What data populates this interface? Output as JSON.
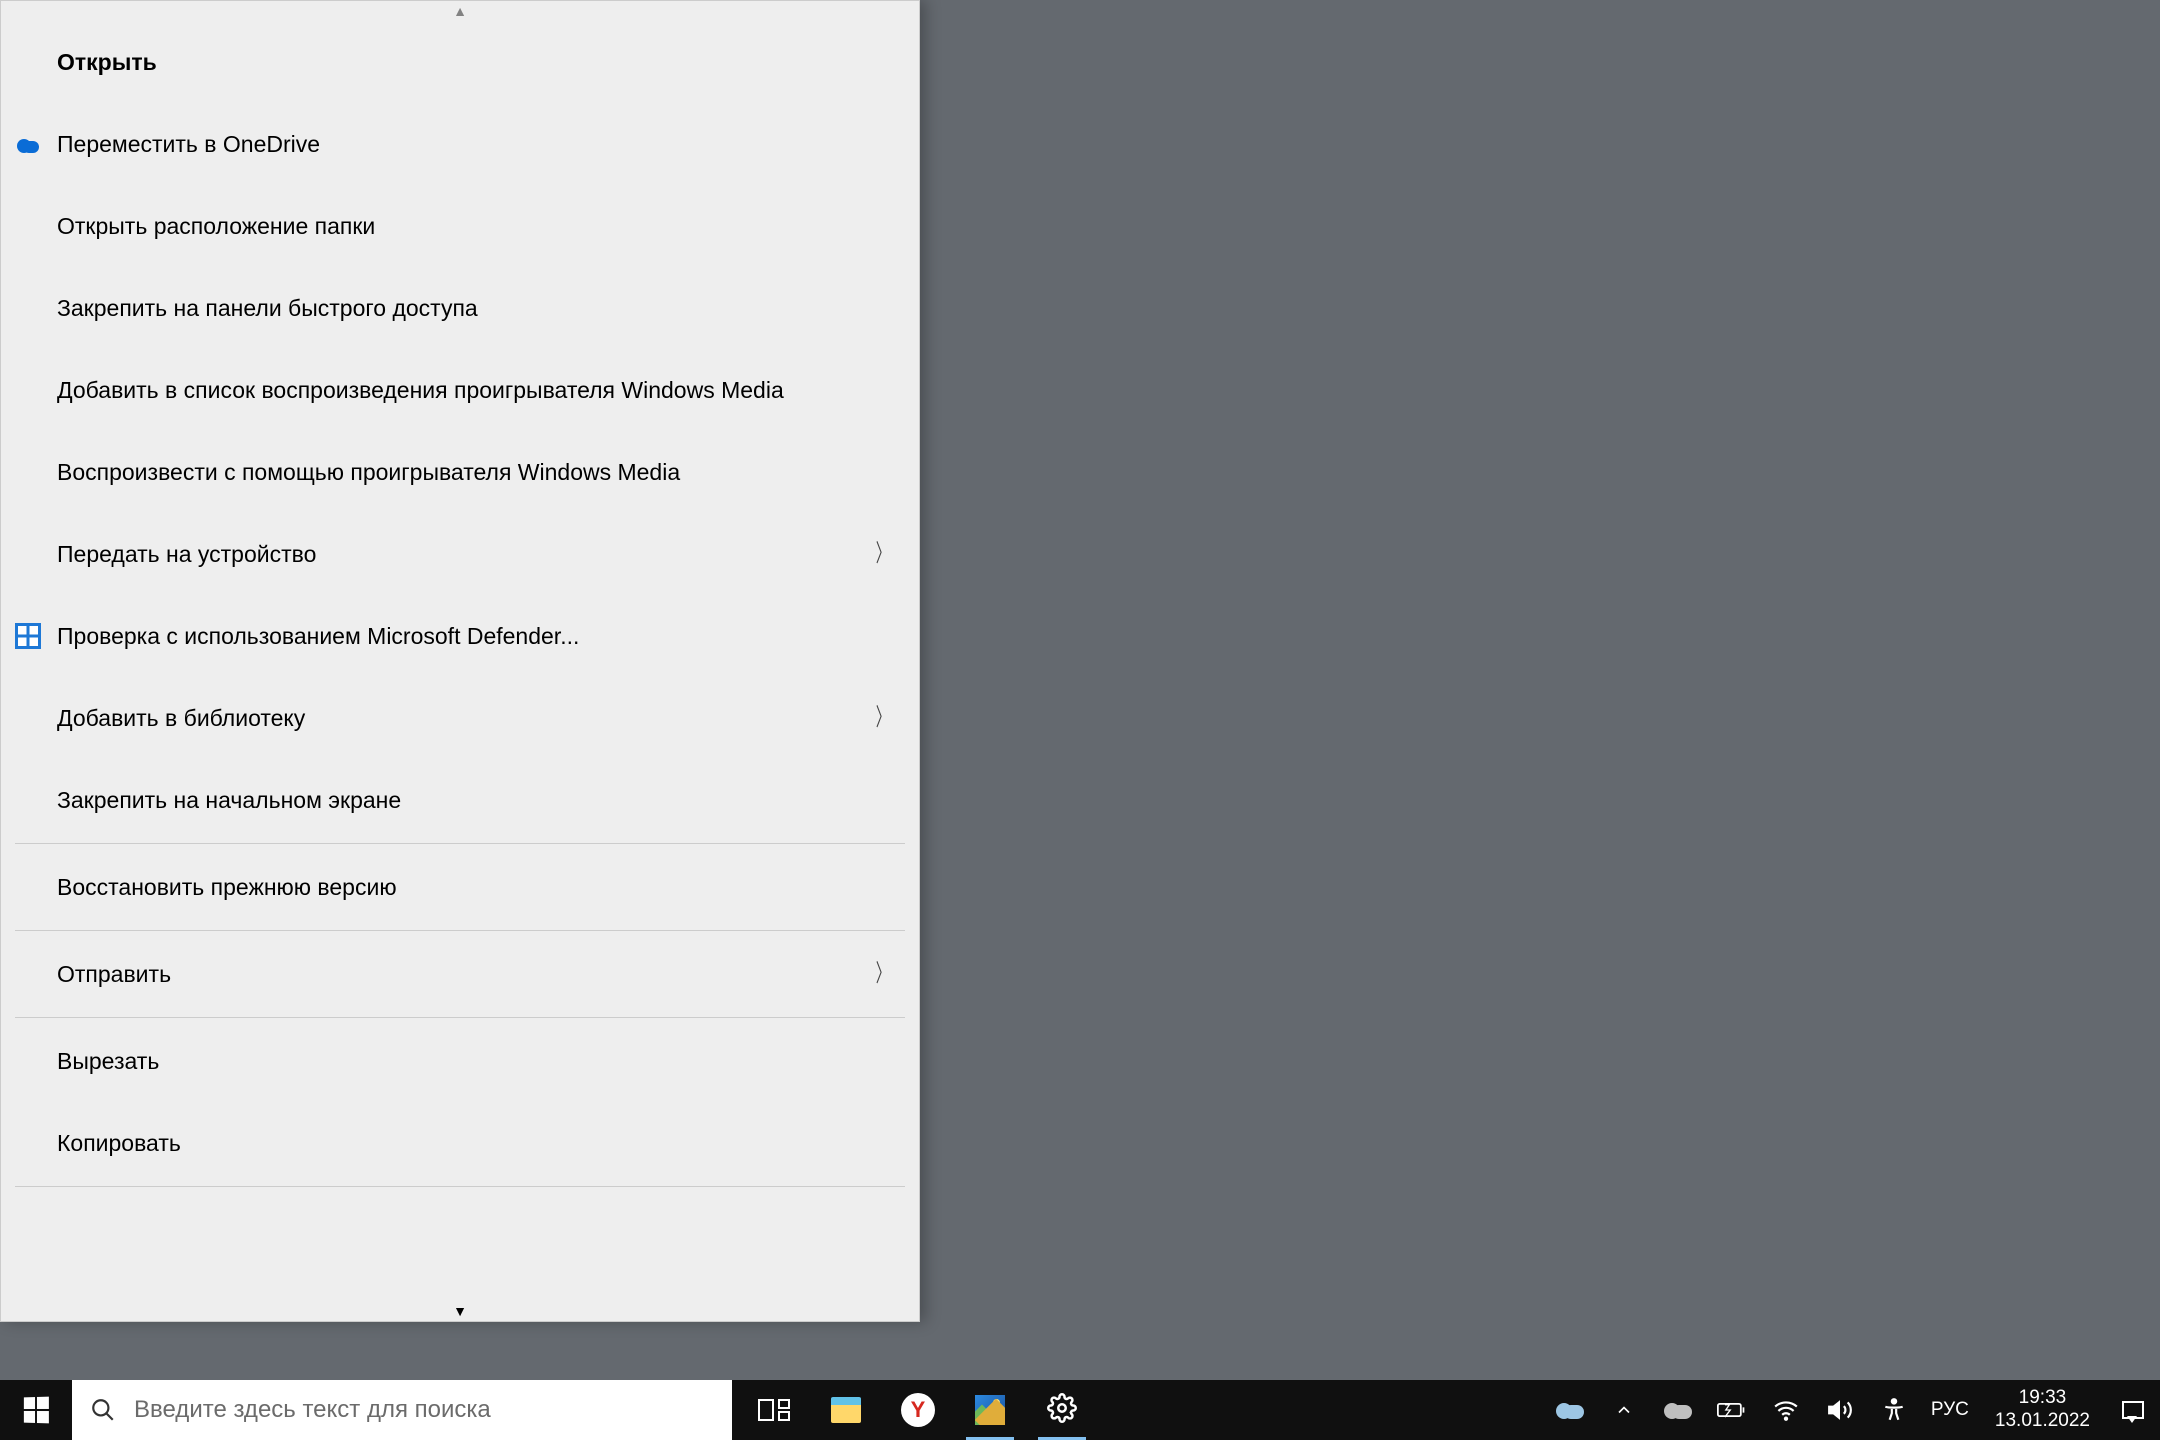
{
  "menu": {
    "items": [
      {
        "label": "Открыть",
        "bold": true,
        "icon": null,
        "submenu": false
      },
      {
        "label": "Переместить в OneDrive",
        "bold": false,
        "icon": "onedrive",
        "submenu": false
      },
      {
        "label": "Открыть расположение папки",
        "bold": false,
        "icon": null,
        "submenu": false
      },
      {
        "label": "Закрепить на панели быстрого доступа",
        "bold": false,
        "icon": null,
        "submenu": false
      },
      {
        "label": "Добавить в список воспроизведения проигрывателя Windows Media",
        "bold": false,
        "icon": null,
        "submenu": false
      },
      {
        "label": "Воспроизвести с помощью проигрывателя Windows Media",
        "bold": false,
        "icon": null,
        "submenu": false
      },
      {
        "label": "Передать на устройство",
        "bold": false,
        "icon": null,
        "submenu": true
      },
      {
        "label": "Проверка с использованием Microsoft Defender...",
        "bold": false,
        "icon": "defender",
        "submenu": false
      },
      {
        "label": "Добавить в библиотеку",
        "bold": false,
        "icon": null,
        "submenu": true
      },
      {
        "label": "Закрепить на начальном экране",
        "bold": false,
        "icon": null,
        "submenu": false
      },
      {
        "label": "Восстановить прежнюю версию",
        "bold": false,
        "icon": null,
        "submenu": false
      },
      {
        "label": "Отправить",
        "bold": false,
        "icon": null,
        "submenu": true
      },
      {
        "label": "Вырезать",
        "bold": false,
        "icon": null,
        "submenu": false
      },
      {
        "label": "Копировать",
        "bold": false,
        "icon": null,
        "submenu": false
      }
    ],
    "separators_after": [
      9,
      10,
      11
    ]
  },
  "taskbar": {
    "search_placeholder": "Введите здесь текст для поиска",
    "lang": "РУС",
    "time": "19:33",
    "date": "13.01.2022"
  }
}
